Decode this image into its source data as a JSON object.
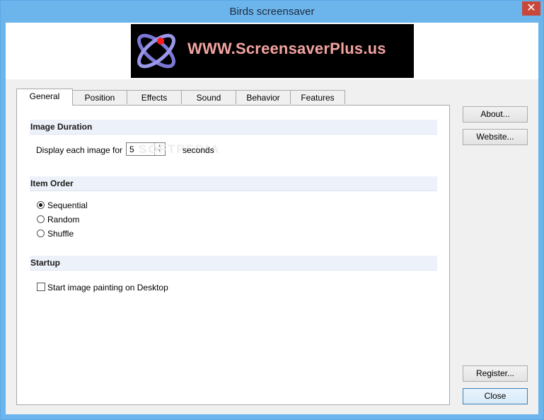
{
  "window": {
    "title": "Birds screensaver",
    "close_glyph": "✕"
  },
  "banner": {
    "text": "WWW.ScreensaverPlus.us",
    "icon": "atom-logo-icon"
  },
  "tabs": [
    {
      "label": "General",
      "active": true
    },
    {
      "label": "Position",
      "active": false
    },
    {
      "label": "Effects",
      "active": false
    },
    {
      "label": "Sound",
      "active": false
    },
    {
      "label": "Behavior",
      "active": false
    },
    {
      "label": "Features",
      "active": false
    }
  ],
  "general": {
    "image_duration": {
      "heading": "Image Duration",
      "prefix_label": "Display each image for",
      "value": "5",
      "suffix_label": "seconds"
    },
    "item_order": {
      "heading": "Item Order",
      "options": [
        {
          "label": "Sequential",
          "selected": true
        },
        {
          "label": "Random",
          "selected": false
        },
        {
          "label": "Shuffle",
          "selected": false
        }
      ]
    },
    "startup": {
      "heading": "Startup",
      "checkbox_label": "Start image painting on Desktop",
      "checked": false
    }
  },
  "buttons": {
    "about": "About...",
    "website": "Website...",
    "register": "Register...",
    "close": "Close"
  },
  "watermark": "SOFTPEDIA"
}
